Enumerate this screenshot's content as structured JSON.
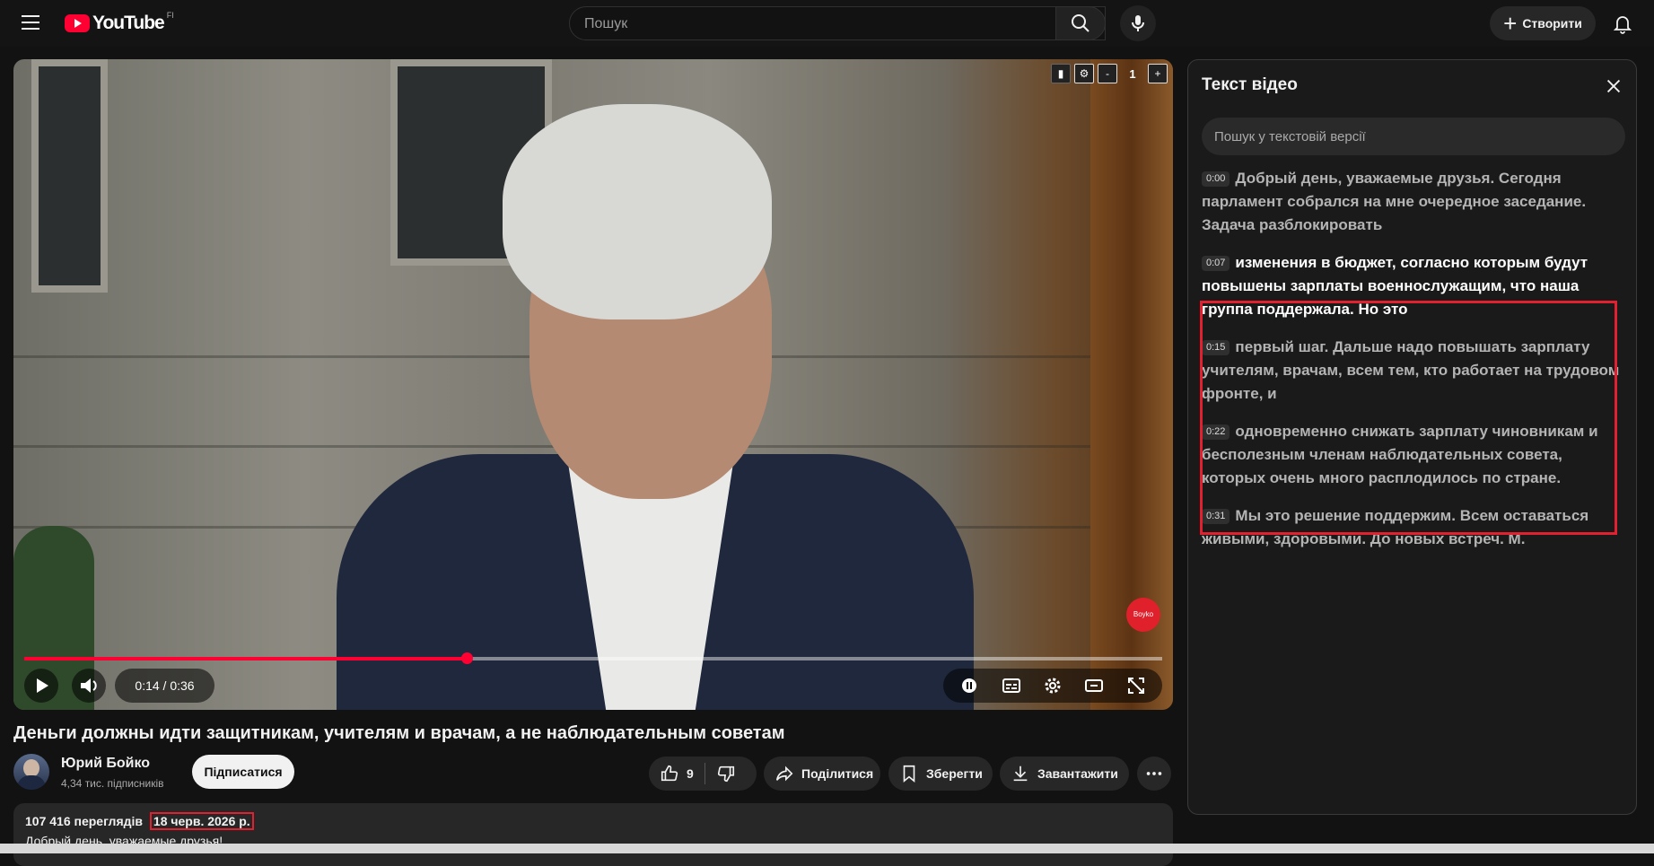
{
  "topbar": {
    "logo_text": "YouTube",
    "country_code": "FI",
    "search_placeholder": "Пошук",
    "create_label": "Створити"
  },
  "player": {
    "time_display": "0:14 / 0:36",
    "progress_fraction": 0.389,
    "speed_value": "1",
    "watermark_text": "Boyko"
  },
  "video": {
    "title": "Деньги должны идти защитникам, учителям и врачам, а не наблюдательным советам",
    "channel_name": "Юрий Бойко",
    "subscribers": "4,34 тис. підписників",
    "subscribe_label": "Підписатися",
    "like_count": "9",
    "share_label": "Поділитися",
    "save_label": "Зберегти",
    "download_label": "Завантажити",
    "views": "107 416 переглядів",
    "date": "18 черв. 2026 р.",
    "description_preview": "Добрый день, уважаемые друзья!"
  },
  "transcript": {
    "title": "Текст відео",
    "search_placeholder": "Пошук у текстовій версії",
    "segments": [
      {
        "time": "0:00",
        "text": "Добрый день, уважаемые друзья. Сегодня парламент собрался на мне очередное заседание. Задача разблокировать"
      },
      {
        "time": "0:07",
        "text": "изменения в бюджет, согласно которым будут повышены зарплаты военнослужащим, что наша группа поддержала. Но это"
      },
      {
        "time": "0:15",
        "text": "первый шаг. Дальше надо повышать зарплату учителям, врачам, всем тем, кто работает на трудовом фронте, и"
      },
      {
        "time": "0:22",
        "text": "одновременно снижать зарплату чиновникам и бесполезным членам наблюдательных совета, которых очень много расплодилось по стране."
      },
      {
        "time": "0:31",
        "text": "Мы это решение поддержим. Всем оставаться живыми, здоровыми. До новых встреч. М."
      }
    ]
  },
  "colors": {
    "accent_red": "#ff0033",
    "annotation_red": "#e3202f"
  }
}
